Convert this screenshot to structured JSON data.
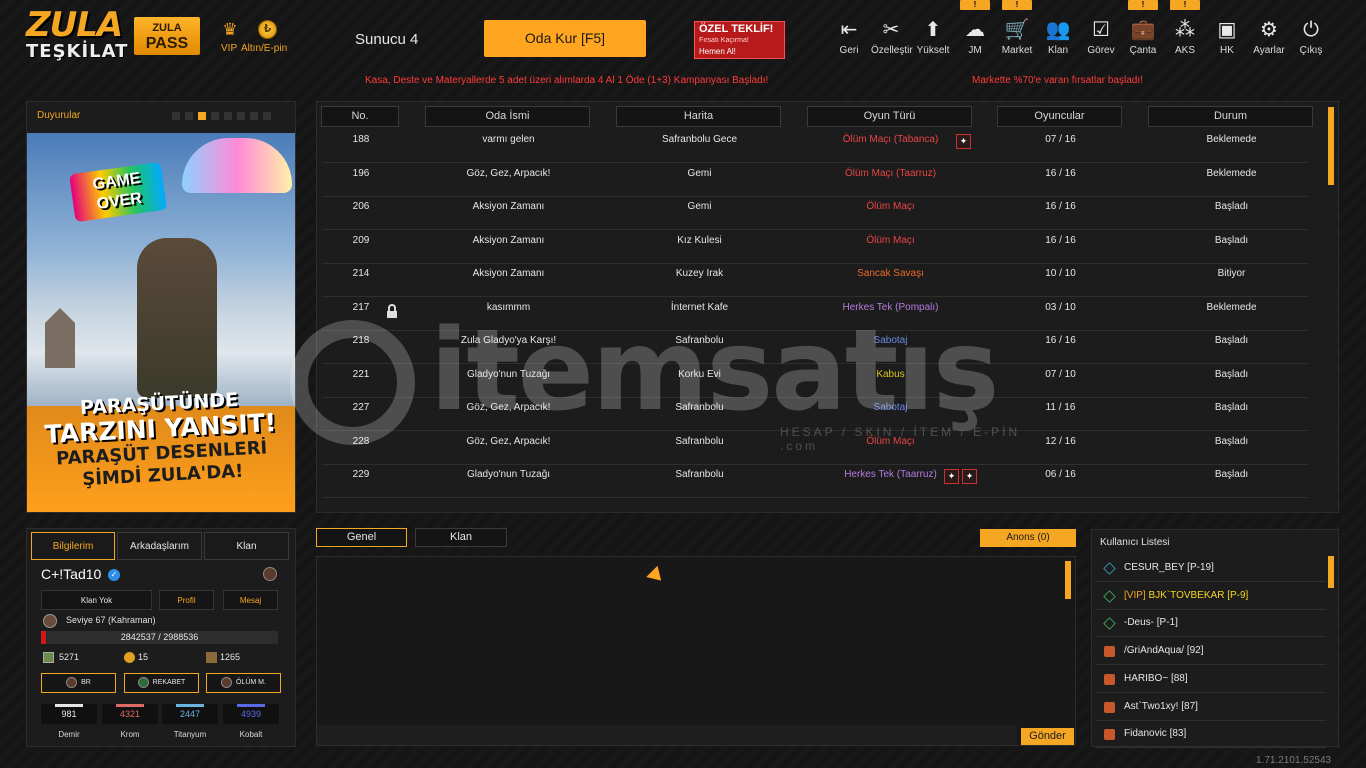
{
  "logo": {
    "line1": "ZULA",
    "line2": "TEŞKİLAT"
  },
  "topbar": {
    "pass": {
      "line1": "ZULA",
      "line2": "PASS"
    },
    "vip_label": "VIP",
    "currency_label": "Altın/E-pin",
    "server": "Sunucu 4",
    "create_room": "Oda Kur [F5]",
    "offer": {
      "title": "ÖZEL TEKLİF!",
      "subtitle": "Fırsatı Kaçırma!",
      "cta": "Hemen Al!"
    }
  },
  "nav": [
    {
      "label": "Geri",
      "icon": "back-icon"
    },
    {
      "label": "Özelleştir",
      "icon": "customize-icon"
    },
    {
      "label": "Yükselt",
      "icon": "upgrade-icon"
    },
    {
      "label": "JM",
      "icon": "jm-icon"
    },
    {
      "label": "Market",
      "icon": "cart-icon"
    },
    {
      "label": "Klan",
      "icon": "clan-icon"
    },
    {
      "label": "Görev",
      "icon": "task-icon"
    },
    {
      "label": "Çanta",
      "icon": "bag-icon"
    },
    {
      "label": "AKS",
      "icon": "aks-icon"
    },
    {
      "label": "HK",
      "icon": "wallet-icon"
    },
    {
      "label": "Ayarlar",
      "icon": "settings-icon"
    },
    {
      "label": "Çıkış",
      "icon": "power-icon"
    }
  ],
  "badges": {
    "jm": "!",
    "market": "!",
    "canta": "!",
    "aks": "!"
  },
  "promos": {
    "left": "Kasa, Deste ve Materyallerde 5 adet üzeri alımlarda 4 Al 1 Öde (1+3) Kampanyası Başladı!",
    "right": "Markette %70'e varan fırsatlar başladı!"
  },
  "announcements": {
    "title": "Duyurular",
    "banner": {
      "badge": "GAME OVER",
      "line1": "PARAŞÜTÜNDE",
      "line2": "TARZINI YANSIT!",
      "line3": "PARAŞÜT DESENLERİ",
      "line4": "ŞİMDİ ZULA'DA!"
    }
  },
  "profile": {
    "tabs": [
      "Bilgilerim",
      "Arkadaşlarım",
      "Klan"
    ],
    "name": "C+!Tad10",
    "buttons": [
      "Klan Yok",
      "Profil",
      "Mesaj"
    ],
    "level": "Seviye 67 (Kahraman)",
    "xp_text": "2842537 / 2988536",
    "xp_fraction": 0.02,
    "stats": [
      {
        "value": "5271"
      },
      {
        "value": "15"
      },
      {
        "value": "1265"
      }
    ],
    "modes": [
      "BR",
      "REKABET",
      "ÖLÜM M."
    ],
    "resources": [
      {
        "value": "981",
        "label": "Demir",
        "color": "#e6e6e6"
      },
      {
        "value": "4321",
        "label": "Krom",
        "color": "#e06a6a"
      },
      {
        "value": "2447",
        "label": "Titanyum",
        "color": "#6ab4e0"
      },
      {
        "value": "4939",
        "label": "Kobalt",
        "color": "#5a6ae6"
      }
    ]
  },
  "rooms": {
    "headers": [
      "No.",
      "Oda İsmi",
      "Harita",
      "Oyun Türü",
      "Oyuncular",
      "Durum"
    ],
    "rows": [
      {
        "no": "188",
        "name": "varmı gelen",
        "map": "Safranbolu Gece",
        "type": "Ölüm Maçı (Tabanca)",
        "color": "#e84545",
        "players": "07 / 16",
        "status": "Beklemede",
        "locked": false,
        "icons": 1
      },
      {
        "no": "196",
        "name": "Göz, Gez, Arpacık!",
        "map": "Gemi",
        "type": "Ölüm Maçı (Taarruz)",
        "color": "#e84545",
        "players": "16 / 16",
        "status": "Beklemede",
        "locked": false,
        "icons": 0
      },
      {
        "no": "206",
        "name": "Aksiyon Zamanı",
        "map": "Gemi",
        "type": "Ölüm Maçı",
        "color": "#e84545",
        "players": "16 / 16",
        "status": "Başladı",
        "locked": false,
        "icons": 0
      },
      {
        "no": "209",
        "name": "Aksiyon Zamanı",
        "map": "Kız Kulesi",
        "type": "Ölüm Maçı",
        "color": "#e84545",
        "players": "16 / 16",
        "status": "Başladı",
        "locked": false,
        "icons": 0
      },
      {
        "no": "214",
        "name": "Aksiyon Zamanı",
        "map": "Kuzey Irak",
        "type": "Sancak Savaşı",
        "color": "#ee6a2a",
        "players": "10 / 10",
        "status": "Bitiyor",
        "locked": false,
        "icons": 0
      },
      {
        "no": "217",
        "name": "kasımmm",
        "map": "İnternet Kafe",
        "type": "Herkes Tek (Pompalı)",
        "color": "#b77ae0",
        "players": "03 / 10",
        "status": "Beklemede",
        "locked": true,
        "icons": 0
      },
      {
        "no": "218",
        "name": "Zula Gladyo'ya Karşı!",
        "map": "Safranbolu",
        "type": "Sabotaj",
        "color": "#6a8ae6",
        "players": "16 / 16",
        "status": "Başladı",
        "locked": false,
        "icons": 0
      },
      {
        "no": "221",
        "name": "Gladyo'nun Tuzağı",
        "map": "Korku Evi",
        "type": "Kabus",
        "color": "#d6c21a",
        "players": "07 / 10",
        "status": "Başladı",
        "locked": false,
        "icons": 0
      },
      {
        "no": "227",
        "name": "Göz, Gez, Arpacık!",
        "map": "Safranbolu",
        "type": "Sabotaj",
        "color": "#6a8ae6",
        "players": "11 / 16",
        "status": "Başladı",
        "locked": false,
        "icons": 0
      },
      {
        "no": "228",
        "name": "Göz, Gez, Arpacık!",
        "map": "Safranbolu",
        "type": "Ölüm Maçı",
        "color": "#e84545",
        "players": "12 / 16",
        "status": "Başladı",
        "locked": false,
        "icons": 0
      },
      {
        "no": "229",
        "name": "Gladyo'nun Tuzağı",
        "map": "Safranbolu",
        "type": "Herkes Tek (Taarruz)",
        "color": "#b77ae0",
        "players": "06 / 16",
        "status": "Başladı",
        "locked": false,
        "icons": 2
      }
    ]
  },
  "watermark": {
    "brand": "itemsatış",
    "tagline": "HESAP / SKIN / İTEM / E-PİN .com"
  },
  "chat": {
    "tabs": [
      "Genel",
      "Klan"
    ],
    "announce": "Anons (0)",
    "send": "Gönder"
  },
  "users": {
    "title": "Kullanıcı Listesi",
    "list": [
      {
        "name": "CESUR_BEY [P-19]",
        "icon": "d",
        "vip": false
      },
      {
        "name": "BJK`TOVBEKAR [P-9]",
        "icon": "g",
        "vip": true,
        "vip_tag": "[VIP]"
      },
      {
        "name": "-Deus- [P-1]",
        "icon": "g",
        "vip": false
      },
      {
        "name": "/GriAndAqua/ [92]",
        "icon": "r",
        "vip": false
      },
      {
        "name": "HARIBO~ [88]",
        "icon": "r",
        "vip": false
      },
      {
        "name": "Ast`Two1xy! [87]",
        "icon": "r",
        "vip": false
      },
      {
        "name": "Fidanovic [83]",
        "icon": "r",
        "vip": false
      }
    ]
  },
  "version": "1.71.2101.52543"
}
